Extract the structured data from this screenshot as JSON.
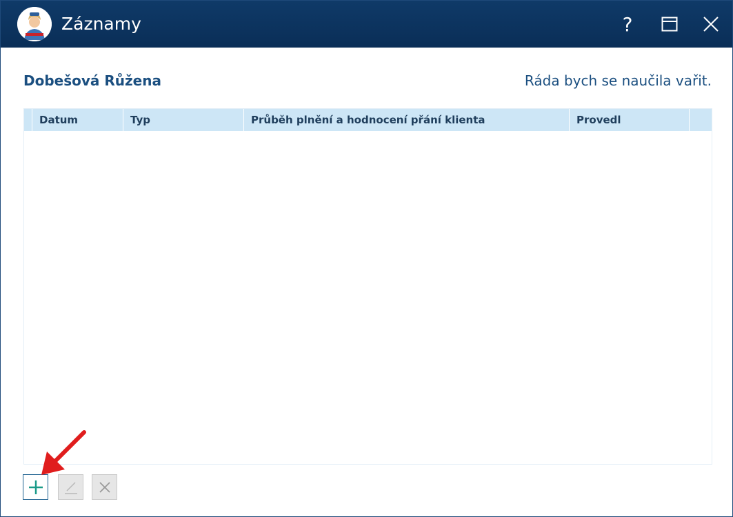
{
  "window": {
    "title": "Záznamy",
    "help_label": "?"
  },
  "header": {
    "client_name": "Dobešová Růžena",
    "wish": "Ráda bych se naučila vařit."
  },
  "grid": {
    "columns": [
      "Datum",
      "Typ",
      "Průběh plnění a hodnocení přání klienta",
      "Provedl"
    ],
    "rows": []
  },
  "toolbar": {
    "add_icon": "plus-icon",
    "edit_icon": "pencil-icon",
    "delete_icon": "close-icon"
  },
  "colors": {
    "titlebar": "#0f3a68",
    "accent_text": "#1b4f80",
    "grid_header": "#cde6f6",
    "add_icon": "#1a9a88",
    "arrow": "#e01d1d"
  }
}
